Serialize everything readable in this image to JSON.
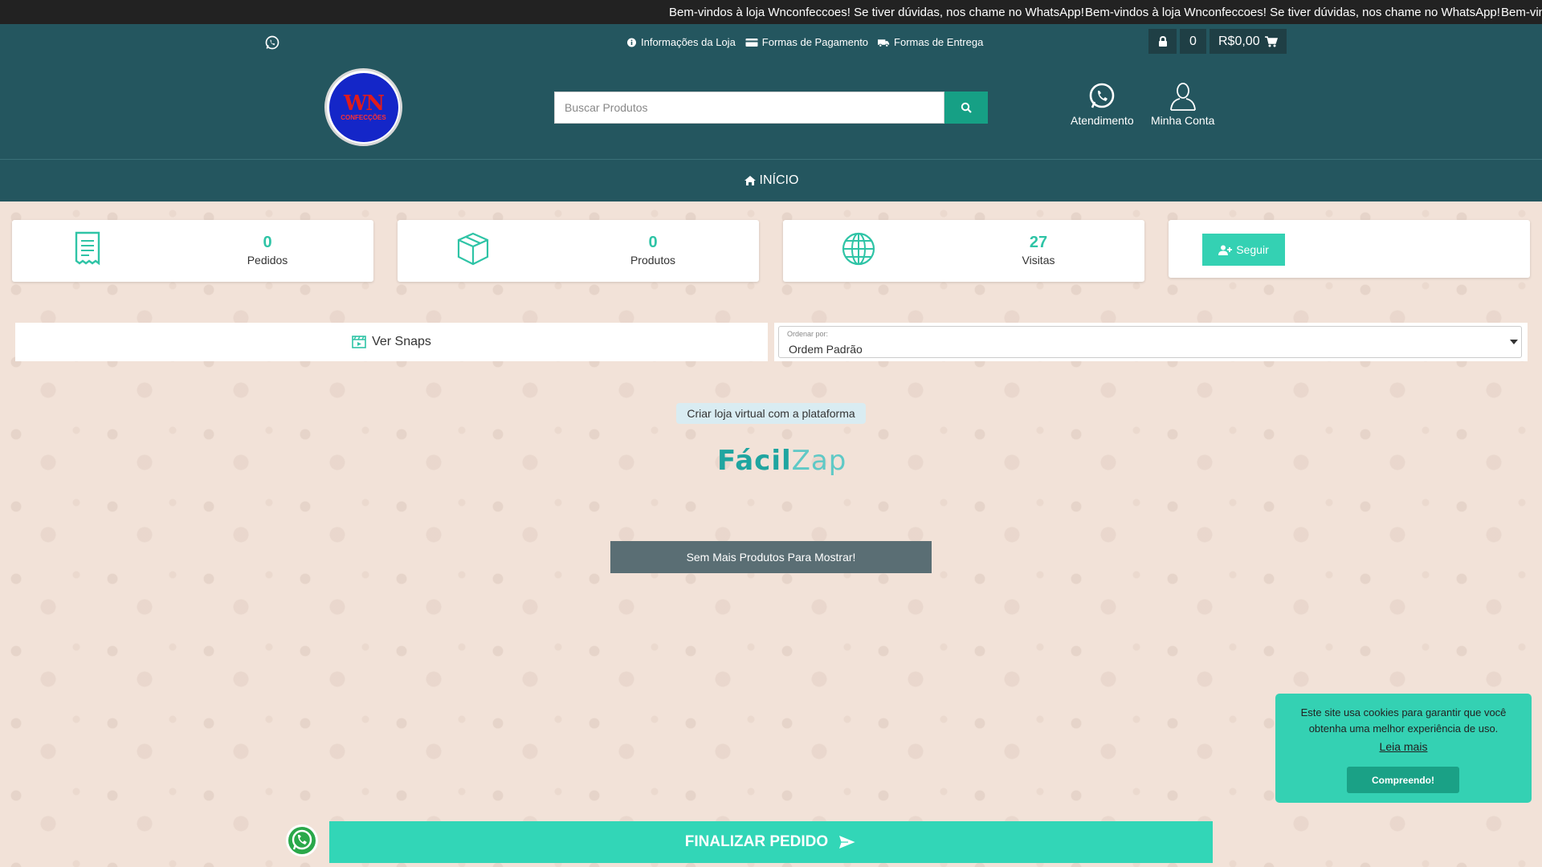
{
  "marquee": {
    "text": "Bem-vindos à loja Wnconfeccoes! Se tiver dúvidas, nos chame no WhatsApp!",
    "text_partial": "Bem-vin"
  },
  "header": {
    "links": [
      {
        "label": "Informações da Loja",
        "icon": "info-icon"
      },
      {
        "label": "Formas de Pagamento",
        "icon": "credit-card-icon"
      },
      {
        "label": "Formas de Entrega",
        "icon": "truck-icon"
      }
    ],
    "cart_count": "0",
    "cart_total": "R$0,00",
    "logo": {
      "title": "WN",
      "subtitle": "CONFECÇÕES"
    },
    "search": {
      "placeholder": "Buscar Produtos"
    },
    "support_label": "Atendimento",
    "account_label": "Minha Conta"
  },
  "nav": {
    "home_label": "INÍCIO"
  },
  "stats": [
    {
      "value": "0",
      "label": "Pedidos",
      "icon": "receipt-icon"
    },
    {
      "value": "0",
      "label": "Produtos",
      "icon": "box-icon"
    },
    {
      "value": "27",
      "label": "Visitas",
      "icon": "globe-icon"
    }
  ],
  "follow_label": "Seguir",
  "snaps_label": "Ver Snaps",
  "sort": {
    "label": "Ordenar por:",
    "selected": "Ordem Padrão"
  },
  "platform": {
    "text": "Criar loja virtual com a plataforma",
    "brand_a": "Fácil",
    "brand_b": "Zap"
  },
  "no_more_label": "Sem Mais Produtos Para Mostrar!",
  "cookie": {
    "message": "Este site usa cookies para garantir que você obtenha uma melhor experiência de uso.",
    "more_label": "Leia mais",
    "ok_label": "Compreendo!"
  },
  "finalize_label": "FINALIZAR PEDIDO",
  "colors": {
    "header": "#24565f",
    "accent": "#34d1b3",
    "background": "#f2e2d8"
  }
}
